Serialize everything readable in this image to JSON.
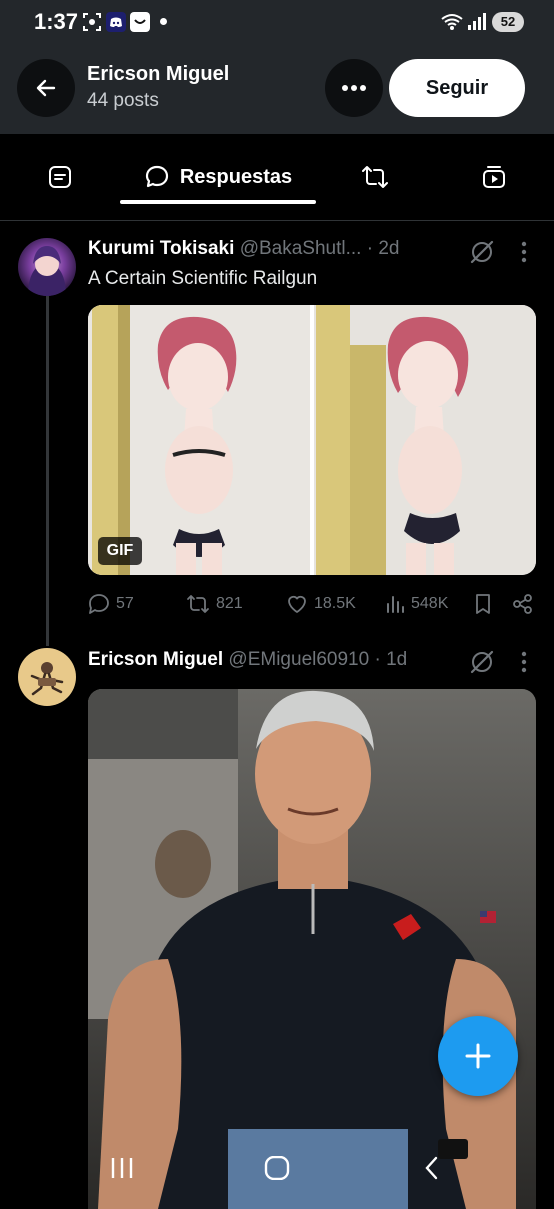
{
  "status_bar": {
    "time": "1:37",
    "battery": "52"
  },
  "header": {
    "name": "Ericson Miguel",
    "posts": "44 posts",
    "follow_label": "Seguir"
  },
  "tabs": {
    "active_label": "Respuestas"
  },
  "posts": [
    {
      "name": "Kurumi Tokisaki",
      "handle": "@BakaShutl...",
      "time": "· 2d",
      "text": "A Certain Scientific Railgun",
      "media_badge": "GIF",
      "replies": "57",
      "reposts": "821",
      "likes": "18.5K",
      "views": "548K"
    },
    {
      "name": "Ericson Miguel",
      "handle": "@EMiguel60910",
      "time": "· 1d"
    }
  ],
  "colors": {
    "accent": "#1d9bf0",
    "background": "#000000",
    "header_bg": "#23272b"
  }
}
